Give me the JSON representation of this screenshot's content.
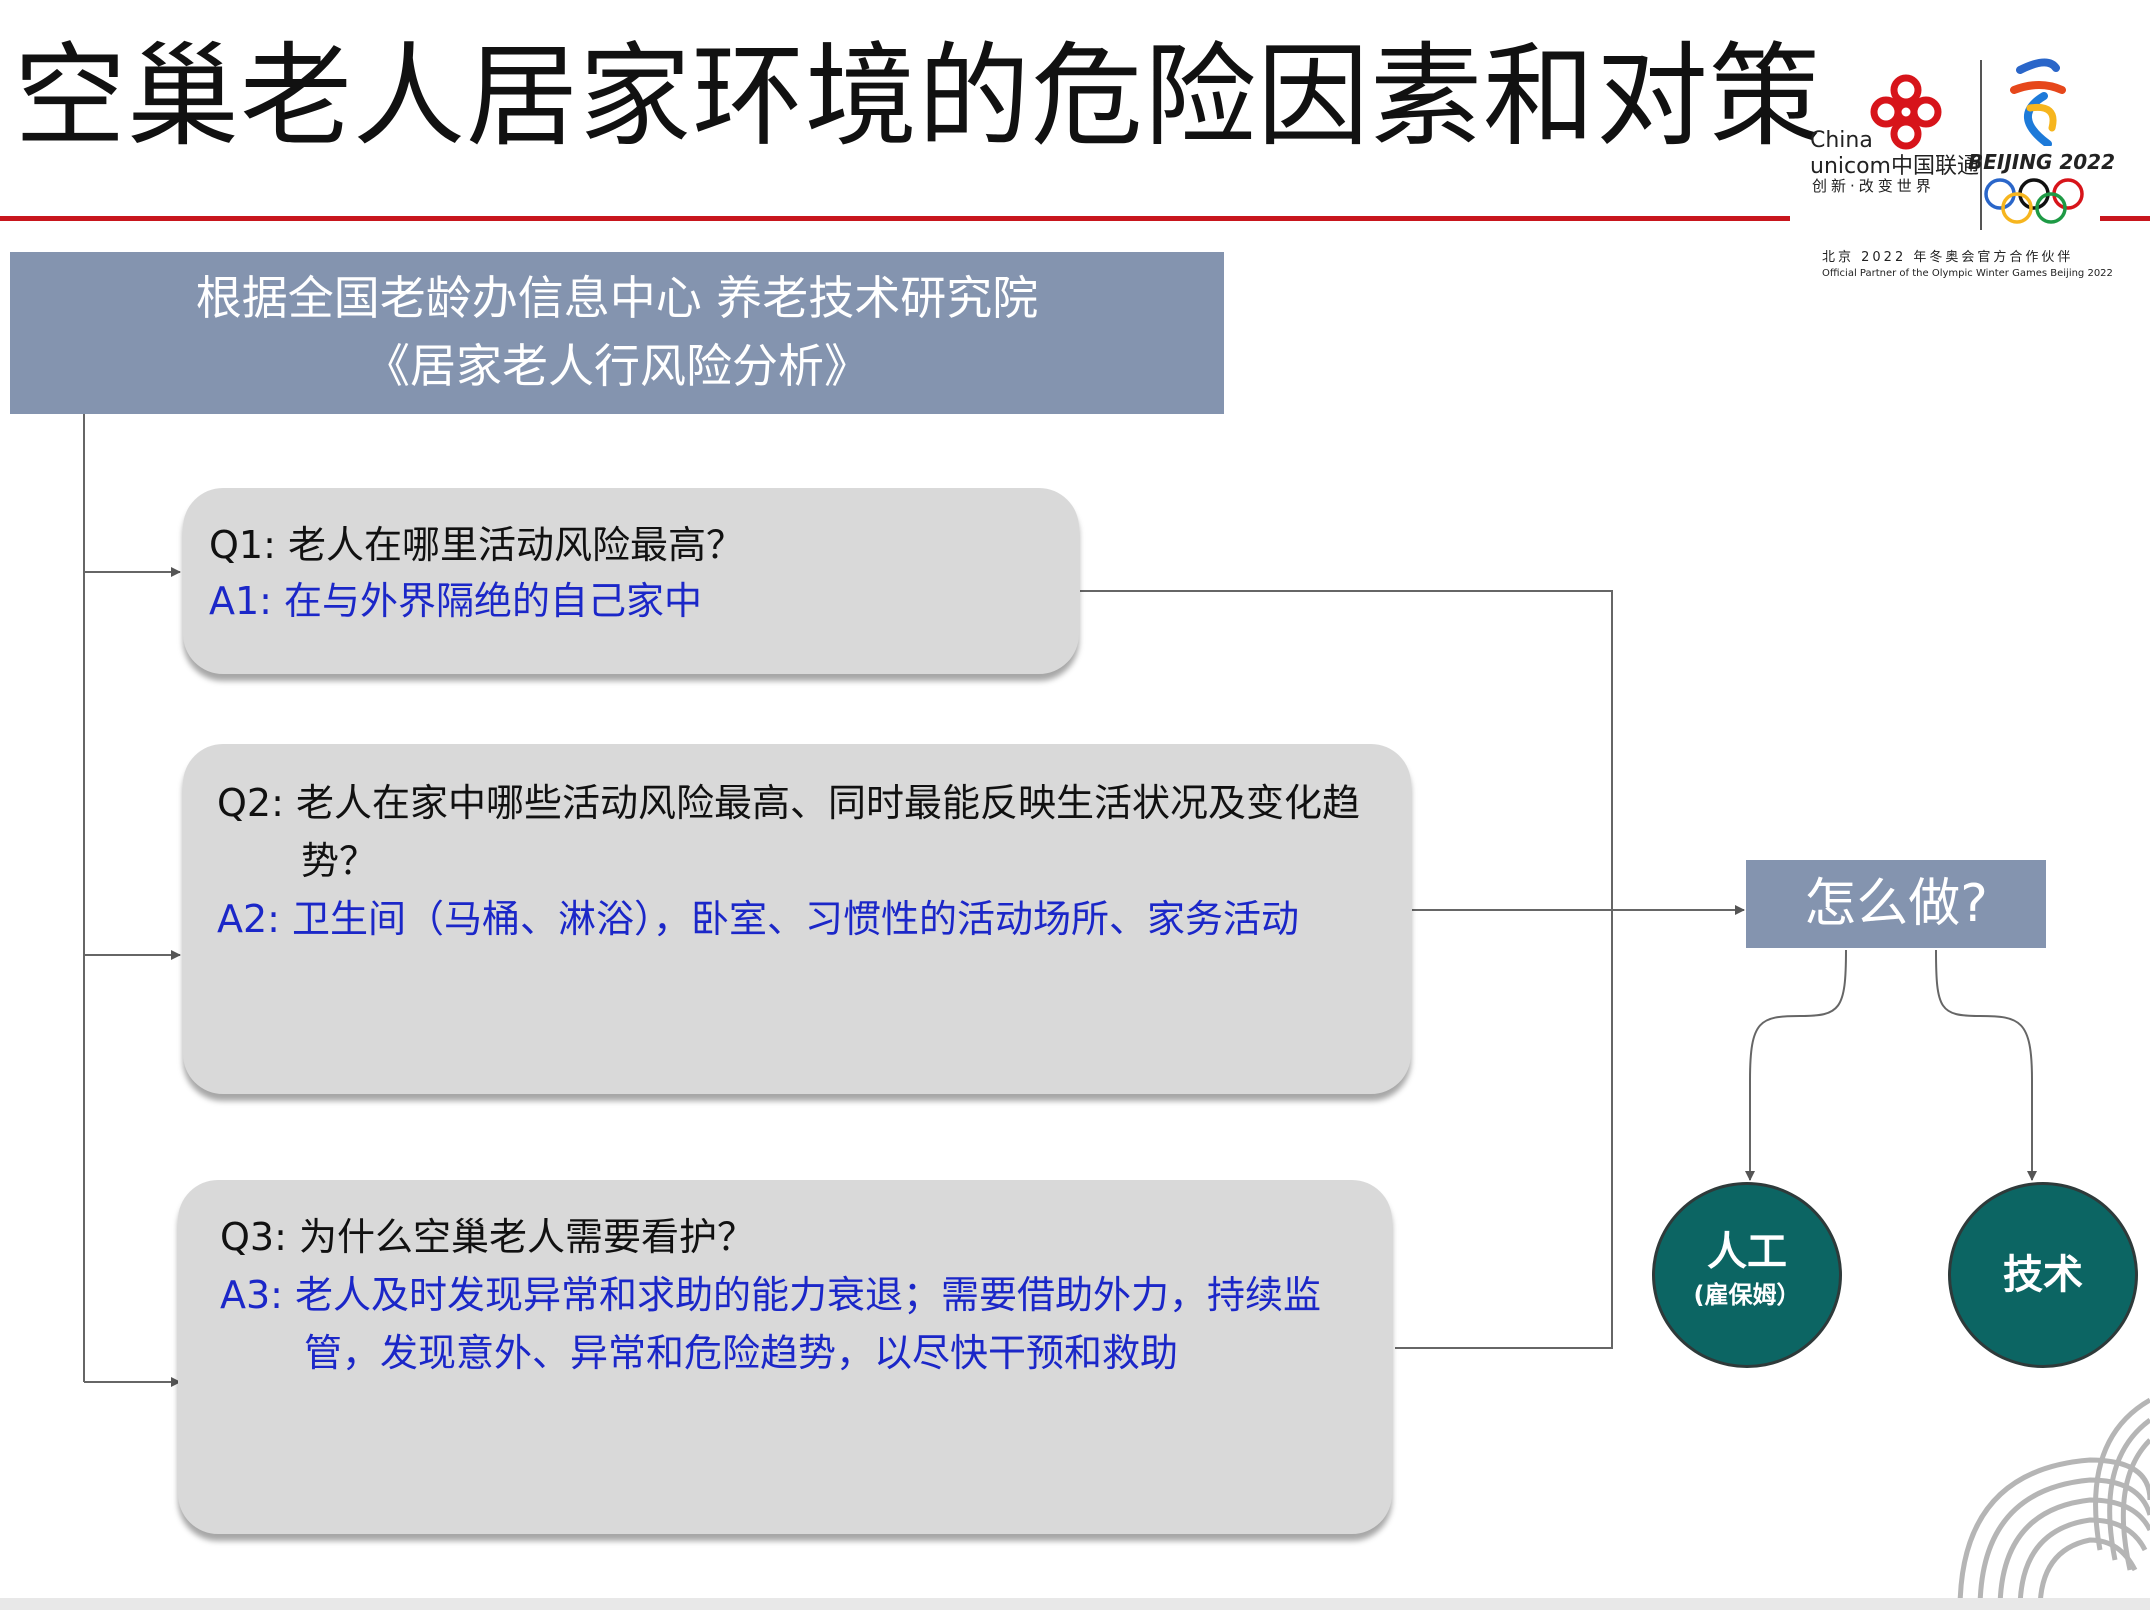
{
  "title": "空巢老人居家环境的危险因素和对策",
  "source": {
    "line1": "根据全国老龄办信息中心  养老技术研究院",
    "line2": "《居家老人行风险分析》"
  },
  "cards": [
    {
      "q": "Q1: 老人在哪里活动风险最高？",
      "a": "A1: 在与外界隔绝的自己家中"
    },
    {
      "q1": "Q2: 老人在家中哪些活动风险最高、同时最能反映生活状况及变化趋",
      "q2": "势？",
      "a": "A2: 卫生间（马桶、淋浴），卧室、习惯性的活动场所、家务活动"
    },
    {
      "q": "Q3: 为什么空巢老人需要看护？",
      "a1": "A3: 老人及时发现异常和求助的能力衰退；需要借助外力，持续监",
      "a2": "管，发现意外、异常和危险趋势，以尽快干预和救助"
    }
  ],
  "how": "怎么做?",
  "options": {
    "manual_main": "人工",
    "manual_sub": "(雇保姆）",
    "tech": "技术"
  },
  "logo": {
    "china": "China",
    "unicom": "unicom中国联通",
    "slogan": "创新·改变世界",
    "beijing": "BEIJING 2022",
    "partner_cn": "北京 2022 年冬奥会官方合作伙伴",
    "partner_en": "Official Partner of the Olympic Winter Games Beijing 2022"
  },
  "colors": {
    "accent_red": "#c8161d",
    "header_blue_gray": "#8494af",
    "answer_blue": "#1b27c8",
    "circle_teal": "#0c6563",
    "card_gray": "#d9d9d9"
  }
}
